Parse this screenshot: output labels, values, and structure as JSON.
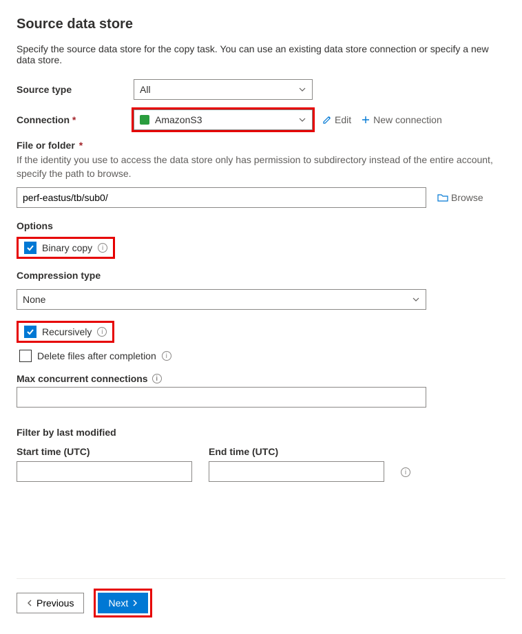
{
  "page": {
    "title": "Source data store",
    "description": "Specify the source data store for the copy task. You can use an existing data store connection or specify a new data store."
  },
  "sourceType": {
    "label": "Source type",
    "value": "All"
  },
  "connection": {
    "label": "Connection",
    "value": "AmazonS3",
    "editLabel": "Edit",
    "newLabel": "New connection"
  },
  "fileFolder": {
    "label": "File or folder",
    "help": "If the identity you use to access the data store only has permission to subdirectory instead of the entire account, specify the path to browse.",
    "value": "perf-eastus/tb/sub0/",
    "browseLabel": "Browse"
  },
  "options": {
    "header": "Options",
    "binaryCopy": {
      "label": "Binary copy",
      "checked": true
    },
    "compression": {
      "label": "Compression type",
      "value": "None"
    },
    "recursively": {
      "label": "Recursively",
      "checked": true
    },
    "deleteAfter": {
      "label": "Delete files after completion",
      "checked": false
    },
    "maxConnections": {
      "label": "Max concurrent connections",
      "value": ""
    }
  },
  "filter": {
    "header": "Filter by last modified",
    "startLabel": "Start time (UTC)",
    "endLabel": "End time (UTC)",
    "startValue": "",
    "endValue": ""
  },
  "footer": {
    "previous": "Previous",
    "next": "Next"
  }
}
